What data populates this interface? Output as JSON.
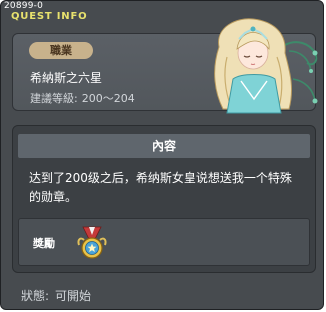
{
  "header": {
    "quest_id": "20899-0",
    "title": "QUEST INFO"
  },
  "summary": {
    "job_tag": "職業",
    "quest_name": "希納斯之六星",
    "recommend_label": "建議等級:",
    "recommend_level": "200～204"
  },
  "content": {
    "header": "內容",
    "text": "达到了200级之后，希纳斯女皇说想送我一个特殊的勋章。"
  },
  "reward": {
    "label": "獎勵",
    "icon": "medal-icon"
  },
  "status": {
    "label": "狀態:",
    "value": "可開始"
  },
  "colors": {
    "window_bg": "#474b4f",
    "title_yellow": "#e8e26e",
    "job_tag_bg": "#c8b28c",
    "content_header_bg": "#5f666d"
  }
}
